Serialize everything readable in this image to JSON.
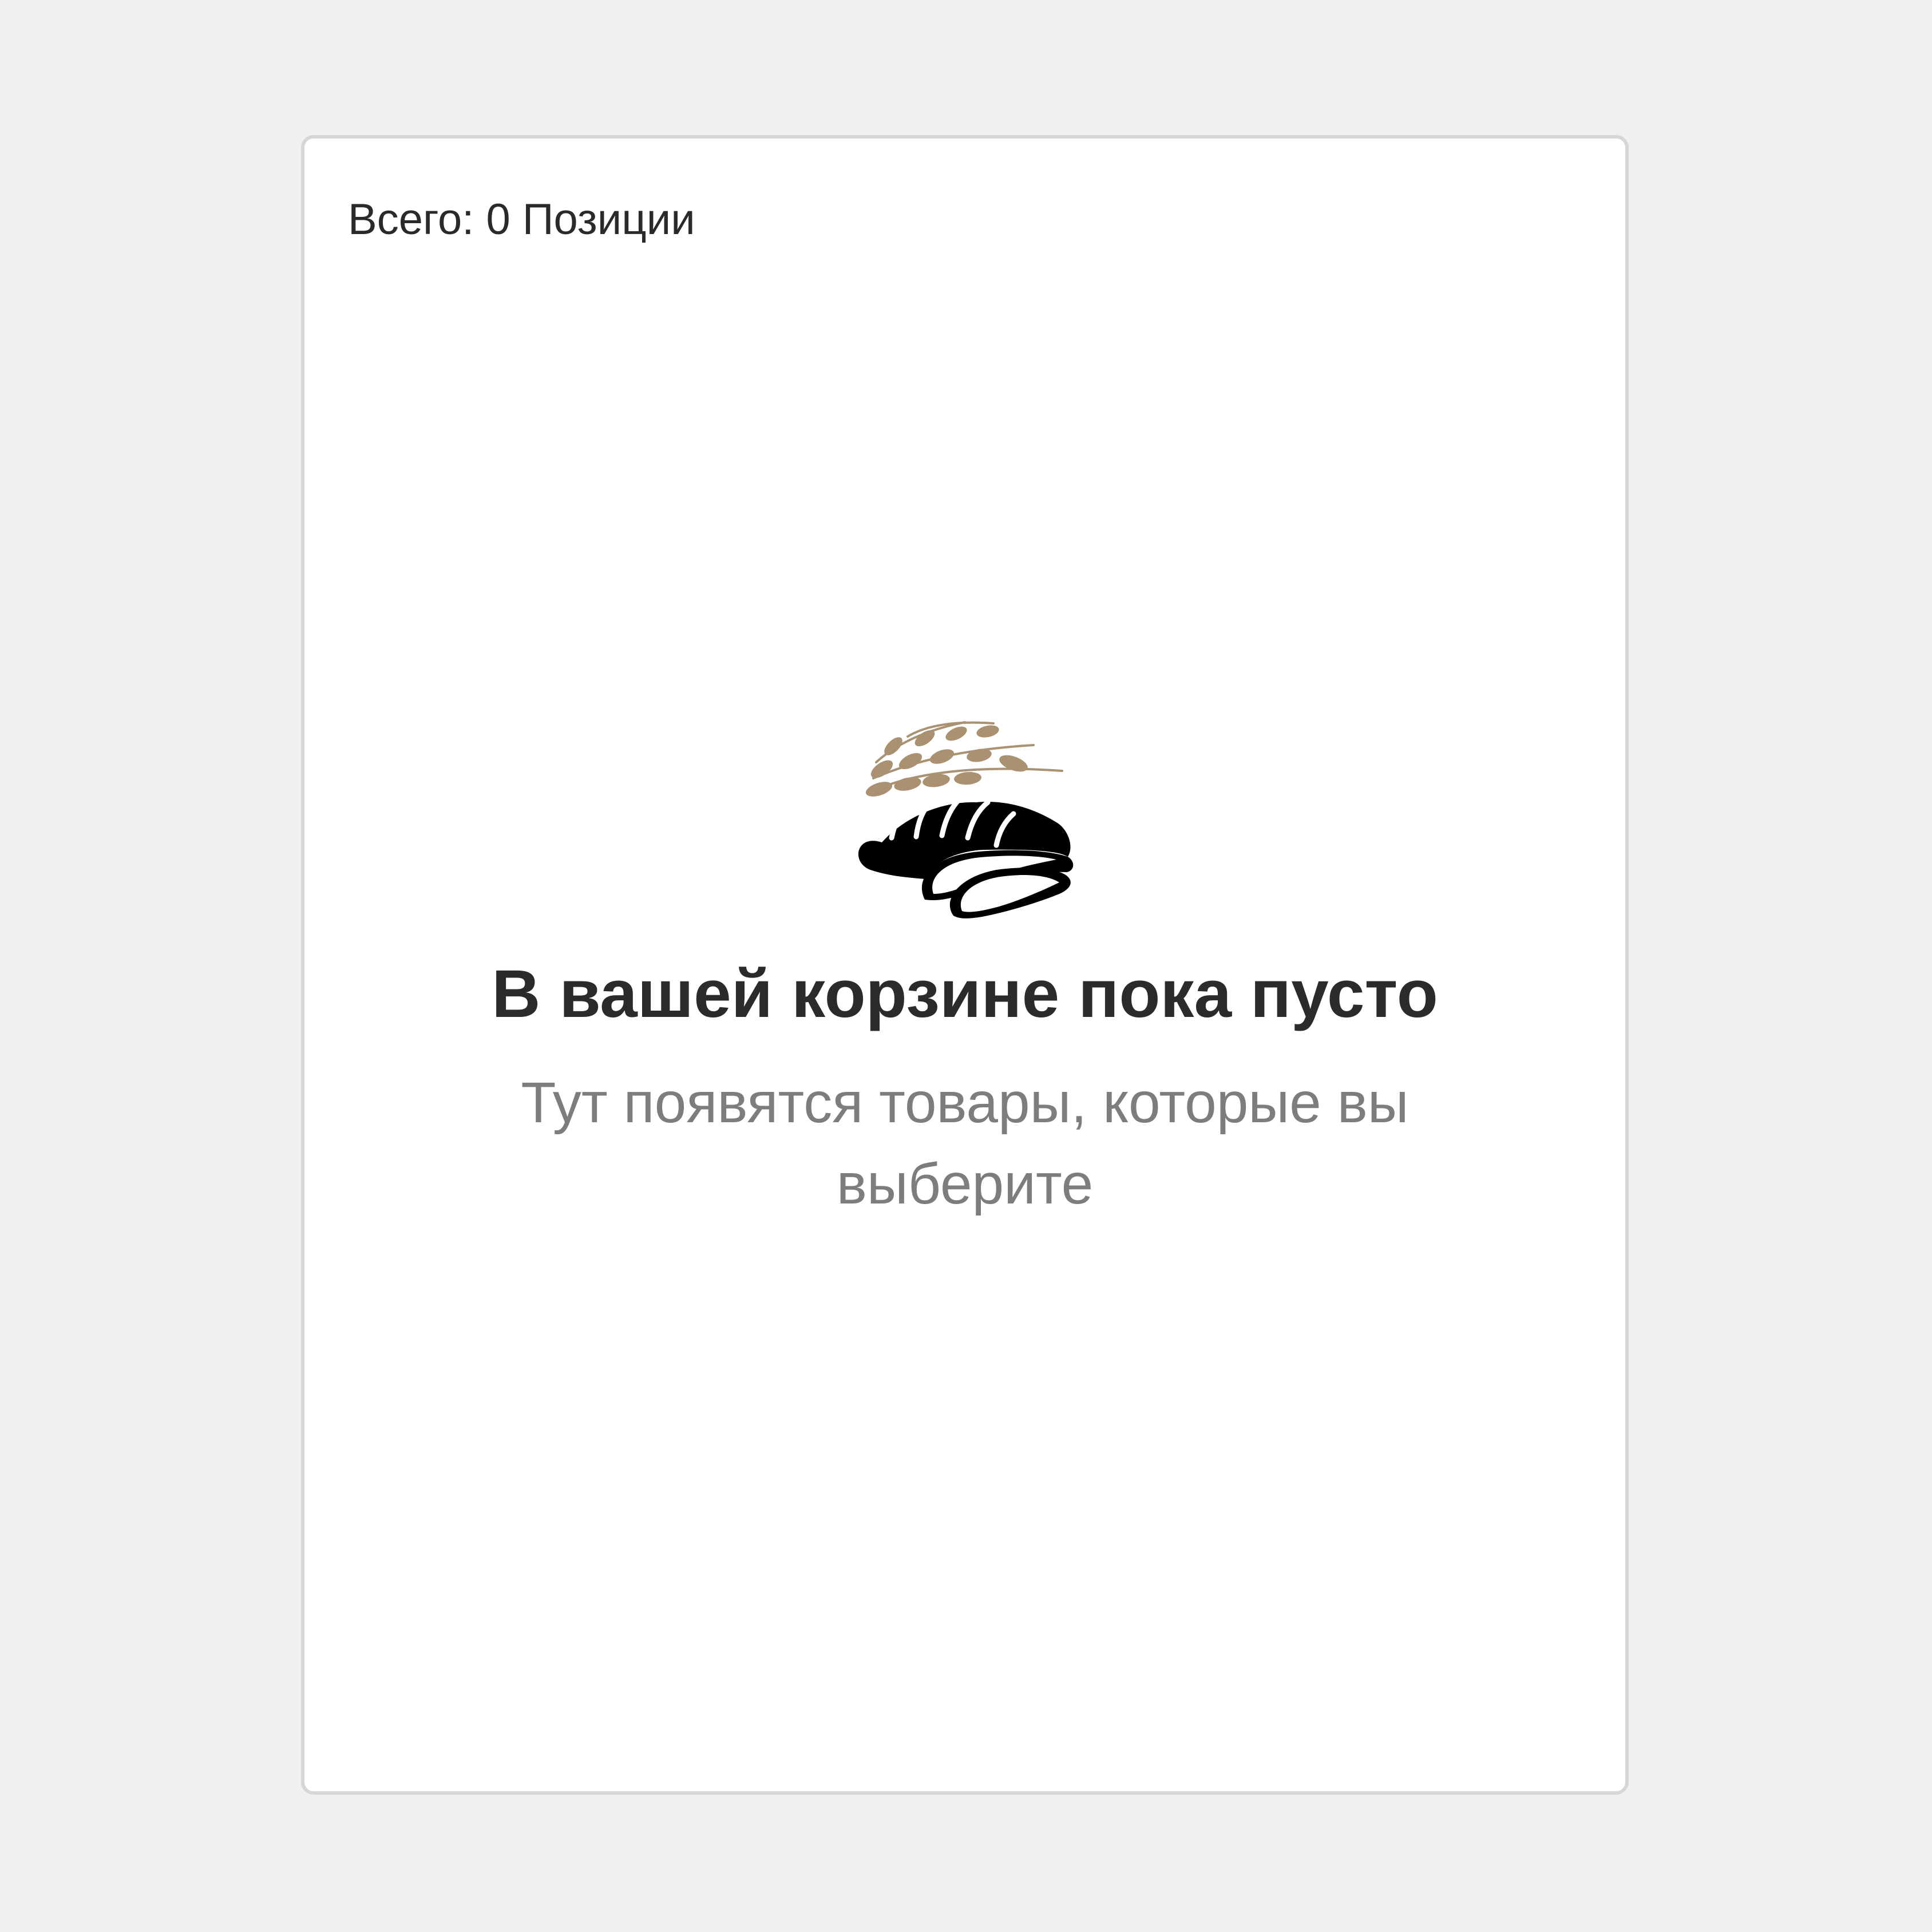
{
  "cart": {
    "total_label": "Всего: 0 Позиции"
  },
  "empty_state": {
    "illustration_icon": "bread-with-wheat-icon",
    "title": "В вашей корзине пока пусто",
    "subtitle": "Тут появятся товары, которые вы выберите"
  },
  "colors": {
    "page_background": "#f0f0f0",
    "panel_background": "#ffffff",
    "panel_border": "#d6d6d6",
    "title_text": "#2b2b2b",
    "subtitle_text": "#7d7d7d",
    "wheat_accent": "#a99172",
    "bread": "#000000"
  }
}
